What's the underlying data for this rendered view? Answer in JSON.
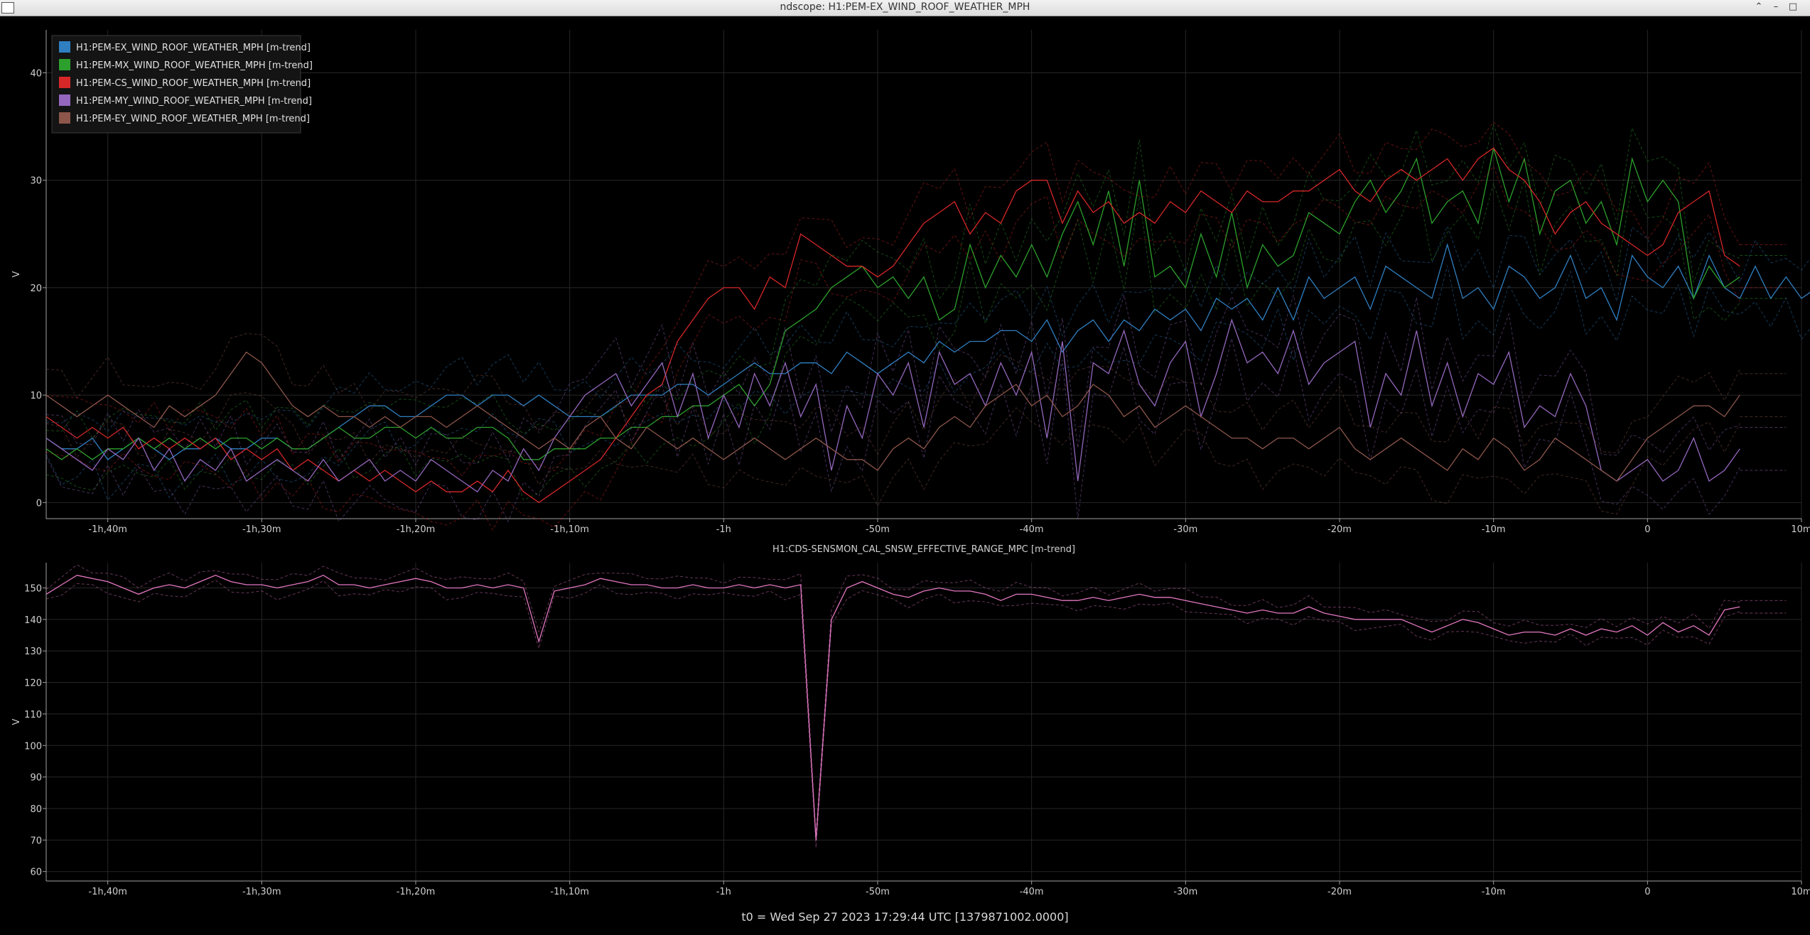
{
  "window": {
    "title": "ndscope: H1:PEM-EX_WIND_ROOF_WEATHER_MPH"
  },
  "footer": {
    "t0": "t0 = Wed Sep 27 2023 17:29:44 UTC [1379871002.0000]"
  },
  "chart_data": [
    {
      "type": "line",
      "title": "",
      "ylabel": "V",
      "xlabel": "",
      "ylim": [
        -1.5,
        44
      ],
      "yticks": [
        0,
        10,
        20,
        30,
        40
      ],
      "xlim": [
        -104,
        10
      ],
      "xticks": [
        {
          "v": -100,
          "label": "-1h,40m"
        },
        {
          "v": -90,
          "label": "-1h,30m"
        },
        {
          "v": -80,
          "label": "-1h,20m"
        },
        {
          "v": -70,
          "label": "-1h,10m"
        },
        {
          "v": -60,
          "label": "-1h"
        },
        {
          "v": -50,
          "label": "-50m"
        },
        {
          "v": -40,
          "label": "-40m"
        },
        {
          "v": -30,
          "label": "-30m"
        },
        {
          "v": -20,
          "label": "-20m"
        },
        {
          "v": -10,
          "label": "-10m"
        },
        {
          "v": 0,
          "label": "0"
        },
        {
          "v": 10,
          "label": "10m"
        }
      ],
      "grid": true,
      "legend_position": "top-left",
      "x_start": -104,
      "x_step": 1,
      "series": [
        {
          "name": "H1:PEM-EX_WIND_ROOF_WEATHER_MPH [m-trend]",
          "color": "#2f7fc1",
          "values": [
            6,
            5,
            5,
            6,
            4,
            5,
            6,
            5,
            4,
            5,
            5,
            6,
            5,
            5,
            6,
            6,
            5,
            5,
            6,
            7,
            8,
            9,
            9,
            8,
            8,
            9,
            10,
            10,
            9,
            10,
            10,
            9,
            10,
            9,
            8,
            8,
            8,
            9,
            10,
            10,
            10,
            11,
            11,
            10,
            11,
            12,
            13,
            12,
            12,
            13,
            13,
            12,
            14,
            13,
            12,
            13,
            14,
            13,
            15,
            14,
            15,
            15,
            16,
            16,
            15,
            17,
            14,
            16,
            17,
            15,
            17,
            16,
            18,
            17,
            18,
            16,
            19,
            18,
            19,
            17,
            20,
            17,
            21,
            19,
            20,
            21,
            18,
            22,
            21,
            20,
            19,
            24,
            19,
            20,
            18,
            22,
            21,
            19,
            20,
            23,
            19,
            20,
            17,
            23,
            21,
            20,
            22,
            19,
            23,
            20,
            19,
            22,
            19,
            21,
            19,
            20
          ]
        },
        {
          "name": "H1:PEM-MX_WIND_ROOF_WEATHER_MPH [m-trend]",
          "color": "#2ca02c",
          "values": [
            5,
            4,
            5,
            4,
            5,
            5,
            6,
            5,
            6,
            5,
            6,
            5,
            6,
            6,
            5,
            6,
            5,
            5,
            6,
            7,
            6,
            6,
            7,
            7,
            6,
            7,
            6,
            6,
            7,
            7,
            6,
            4,
            4,
            5,
            5,
            5,
            6,
            6,
            7,
            7,
            8,
            8,
            9,
            9,
            10,
            11,
            9,
            11,
            16,
            17,
            18,
            20,
            21,
            22,
            20,
            21,
            19,
            21,
            17,
            18,
            24,
            20,
            23,
            21,
            24,
            21,
            25,
            28,
            24,
            29,
            22,
            30,
            21,
            22,
            20,
            25,
            21,
            27,
            20,
            24,
            22,
            23,
            27,
            26,
            25,
            28,
            30,
            27,
            29,
            32,
            26,
            28,
            29,
            26,
            33,
            28,
            32,
            25,
            29,
            30,
            26,
            28,
            24,
            32,
            28,
            30,
            28,
            19,
            22,
            20,
            21
          ]
        },
        {
          "name": "H1:PEM-CS_WIND_ROOF_WEATHER_MPH [m-trend]",
          "color": "#d62728",
          "values": [
            8,
            7,
            6,
            7,
            6,
            7,
            5,
            6,
            5,
            6,
            5,
            6,
            4,
            5,
            4,
            5,
            3,
            4,
            3,
            2,
            3,
            2,
            3,
            2,
            1,
            2,
            1,
            1,
            2,
            1,
            3,
            1,
            0,
            1,
            2,
            3,
            4,
            6,
            8,
            10,
            11,
            15,
            17,
            19,
            20,
            20,
            18,
            21,
            20,
            25,
            24,
            23,
            22,
            22,
            21,
            22,
            24,
            26,
            27,
            28,
            25,
            27,
            26,
            29,
            30,
            30,
            26,
            29,
            27,
            28,
            26,
            27,
            26,
            28,
            27,
            29,
            28,
            27,
            29,
            28,
            28,
            29,
            29,
            30,
            31,
            29,
            28,
            30,
            31,
            30,
            31,
            32,
            30,
            32,
            33,
            31,
            30,
            28,
            25,
            27,
            28,
            26,
            25,
            24,
            23,
            24,
            27,
            28,
            29,
            23,
            22
          ]
        },
        {
          "name": "H1:PEM-MY_WIND_ROOF_WEATHER_MPH [m-trend]",
          "color": "#9467bd",
          "values": [
            6,
            5,
            4,
            3,
            5,
            4,
            6,
            3,
            5,
            2,
            4,
            3,
            5,
            2,
            3,
            4,
            3,
            2,
            4,
            2,
            3,
            4,
            2,
            3,
            2,
            4,
            3,
            2,
            1,
            3,
            2,
            5,
            3,
            6,
            8,
            10,
            11,
            12,
            9,
            11,
            13,
            8,
            12,
            6,
            10,
            7,
            12,
            9,
            13,
            8,
            11,
            3,
            9,
            6,
            12,
            10,
            13,
            7,
            14,
            11,
            12,
            9,
            13,
            10,
            14,
            6,
            15,
            2,
            13,
            12,
            16,
            11,
            9,
            13,
            15,
            8,
            12,
            17,
            13,
            14,
            12,
            16,
            11,
            13,
            14,
            15,
            7,
            12,
            10,
            16,
            9,
            13,
            8,
            12,
            11,
            14,
            7,
            9,
            8,
            12,
            9,
            3,
            2,
            3,
            4,
            2,
            3,
            6,
            2,
            3,
            5
          ]
        },
        {
          "name": "H1:PEM-EY_WIND_ROOF_WEATHER_MPH [m-trend]",
          "color": "#8c564b",
          "values": [
            10,
            9,
            8,
            9,
            10,
            9,
            8,
            7,
            9,
            8,
            9,
            10,
            12,
            14,
            13,
            11,
            9,
            8,
            9,
            8,
            8,
            7,
            8,
            7,
            8,
            8,
            7,
            8,
            9,
            8,
            7,
            6,
            5,
            6,
            5,
            7,
            8,
            6,
            5,
            7,
            6,
            5,
            6,
            5,
            4,
            5,
            6,
            5,
            4,
            5,
            6,
            5,
            4,
            4,
            3,
            5,
            6,
            5,
            7,
            8,
            7,
            9,
            10,
            11,
            9,
            10,
            8,
            9,
            11,
            10,
            8,
            9,
            7,
            8,
            9,
            8,
            7,
            6,
            6,
            5,
            6,
            6,
            5,
            6,
            7,
            5,
            4,
            5,
            6,
            5,
            4,
            3,
            5,
            4,
            6,
            5,
            3,
            4,
            6,
            5,
            4,
            3,
            2,
            4,
            6,
            7,
            8,
            9,
            9,
            8,
            10
          ]
        }
      ]
    },
    {
      "type": "line",
      "title": "H1:CDS-SENSMON_CAL_SNSW_EFFECTIVE_RANGE_MPC [m-trend]",
      "ylabel": "V",
      "xlabel": "",
      "ylim": [
        57,
        158
      ],
      "yticks": [
        60,
        70,
        80,
        90,
        100,
        110,
        120,
        130,
        140,
        150
      ],
      "xlim": [
        -104,
        10
      ],
      "xticks": [
        {
          "v": -100,
          "label": "-1h,40m"
        },
        {
          "v": -90,
          "label": "-1h,30m"
        },
        {
          "v": -80,
          "label": "-1h,20m"
        },
        {
          "v": -70,
          "label": "-1h,10m"
        },
        {
          "v": -60,
          "label": "-1h"
        },
        {
          "v": -50,
          "label": "-50m"
        },
        {
          "v": -40,
          "label": "-40m"
        },
        {
          "v": -30,
          "label": "-30m"
        },
        {
          "v": -20,
          "label": "-20m"
        },
        {
          "v": -10,
          "label": "-10m"
        },
        {
          "v": 0,
          "label": "0"
        },
        {
          "v": 10,
          "label": "10m"
        }
      ],
      "grid": true,
      "x_start": -104,
      "x_step": 1,
      "series": [
        {
          "name": "H1:CDS-SENSMON_CAL_SNSW_EFFECTIVE_RANGE_MPC [m-trend]",
          "color": "#e377c2",
          "values": [
            148,
            151,
            154,
            153,
            152,
            150,
            148,
            150,
            151,
            150,
            152,
            154,
            152,
            151,
            151,
            150,
            151,
            152,
            154,
            151,
            151,
            150,
            151,
            152,
            153,
            152,
            150,
            150,
            151,
            150,
            151,
            150,
            133,
            149,
            150,
            151,
            153,
            152,
            151,
            151,
            150,
            150,
            151,
            150,
            150,
            151,
            150,
            151,
            150,
            151,
            70,
            140,
            150,
            152,
            150,
            148,
            147,
            149,
            150,
            149,
            149,
            148,
            146,
            148,
            148,
            147,
            146,
            146,
            147,
            146,
            147,
            148,
            147,
            147,
            146,
            145,
            144,
            143,
            142,
            143,
            142,
            142,
            144,
            142,
            141,
            140,
            140,
            140,
            140,
            138,
            136,
            138,
            140,
            139,
            137,
            135,
            136,
            136,
            135,
            137,
            135,
            137,
            136,
            138,
            135,
            139,
            136,
            138,
            135,
            143,
            144
          ]
        }
      ]
    }
  ]
}
